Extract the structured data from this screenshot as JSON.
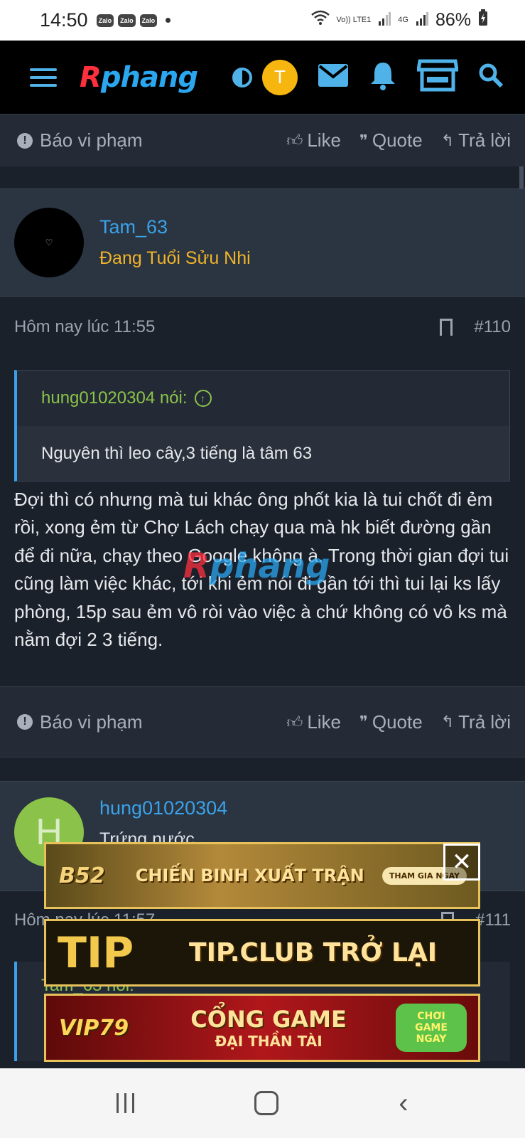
{
  "status_bar": {
    "time": "14:50",
    "notifications": [
      "Zalo",
      "Zalo",
      "Zalo"
    ],
    "network1": "Vo)) LTE1",
    "network2": "4G",
    "battery": "86%"
  },
  "app_bar": {
    "logo_r": "R",
    "logo_rest": "phang",
    "avatar_letter": "T",
    "accent": "#2aa7ef"
  },
  "top_actions": {
    "report": "Báo vi phạm",
    "like": "Like",
    "quote": "Quote",
    "reply": "Trả lời"
  },
  "post_110": {
    "username": "Tam_63",
    "user_title": "Đang Tuổi Sửu Nhi",
    "time": "Hôm nay lúc 11:55",
    "number": "#110",
    "quote_author": "hung01020304 nói:",
    "quote_text": "Nguyên thì leo cây,3 tiếng là tâm 63",
    "body": "Đợi thì có nhưng mà tui khác ông phốt kia là tui chốt đi ẻm rồi, xong ẻm từ Chợ Lách chạy qua mà hk biết đường gần để đi nữa, chạy theo Google không à. Trong thời gian đợi tui cũng làm việc khác, tới khi ẻm nói đi gần tới thì tui lại ks lấy phòng, 15p sau ẻm vô ròi vào việc à chứ không có vô ks mà nằm đợi 2 3 tiếng.",
    "report": "Báo vi phạm",
    "like": "Like",
    "quote": "Quote",
    "reply": "Trả lời"
  },
  "post_111": {
    "username": "hung01020304",
    "user_title": "Trứng nước",
    "avatar_letter": "H",
    "time": "Hôm nay lúc 11:57",
    "number": "#111",
    "quote_author": "Tam_63 nói:"
  },
  "ads": {
    "ad1_brand": "B52",
    "ad1_text": "CHIẾN BINH XUẤT TRẬN",
    "ad1_button": "THAM GIA NGAY",
    "ad2_brand": "TIP",
    "ad2_text": "TIP.CLUB TRỞ LẠI",
    "ad3_brand": "VIP79",
    "ad3_text": "CỔNG GAME",
    "ad3_sub": "ĐẠI THẦN TÀI",
    "ad3_button": "CHƠI GAME NGAY"
  }
}
